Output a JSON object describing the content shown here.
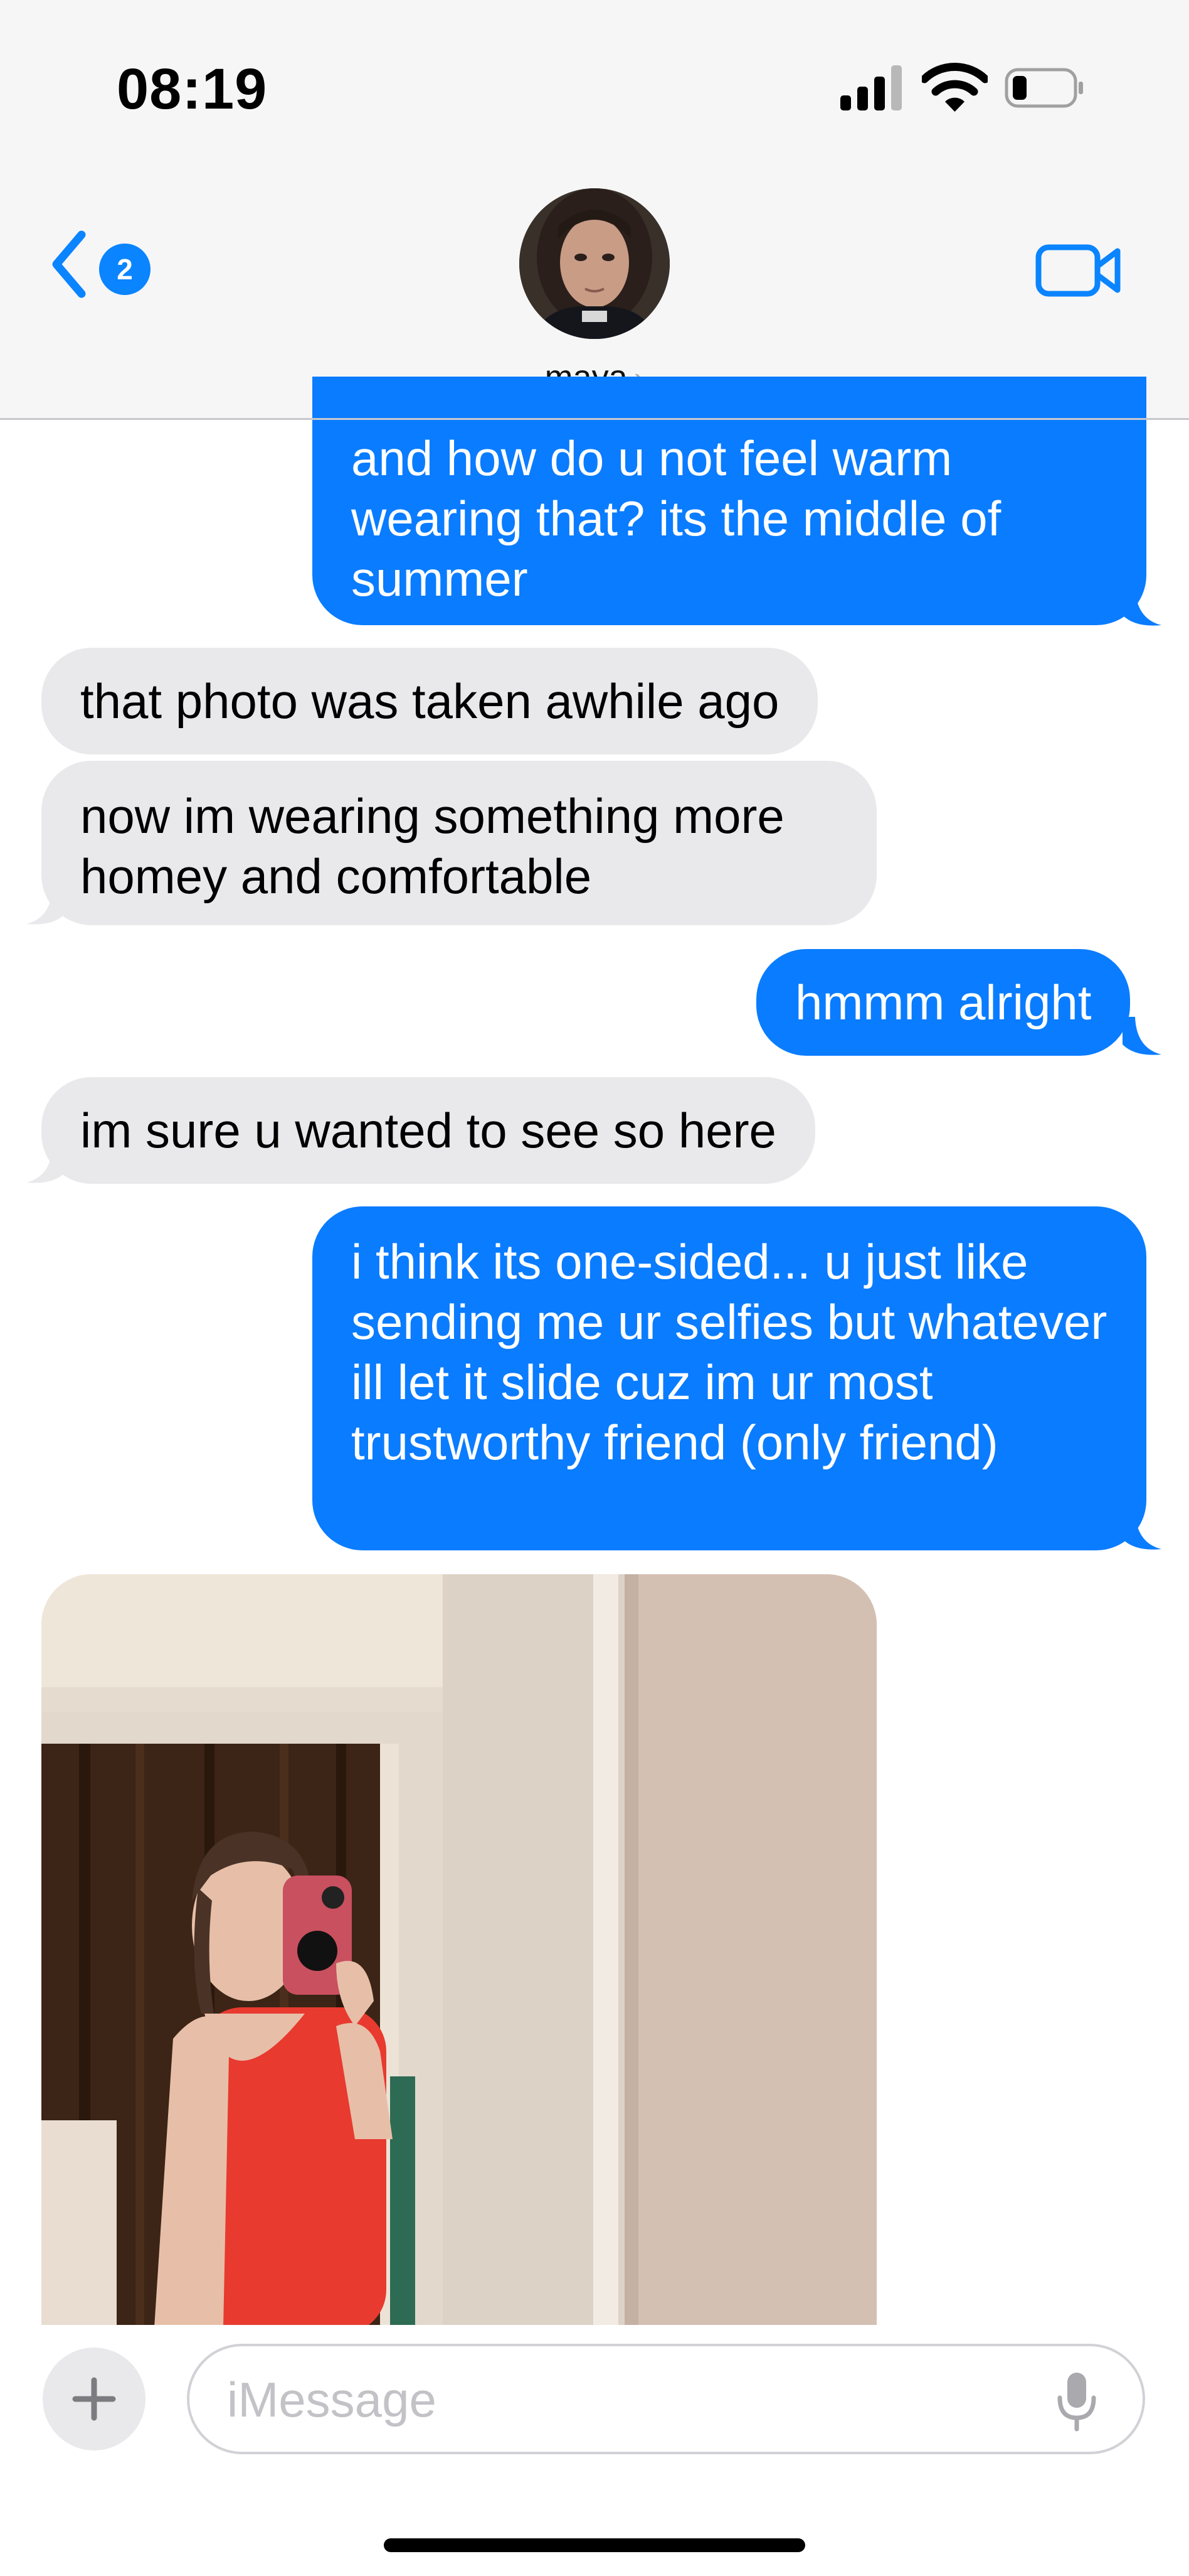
{
  "status_bar": {
    "time": "08:19",
    "icons": [
      "signal-icon",
      "wifi-icon",
      "battery-icon"
    ]
  },
  "header": {
    "back_badge": "2",
    "contact_name": "maya",
    "icons": [
      "back-chevron-icon",
      "video-camera-icon"
    ]
  },
  "messages": [
    {
      "from": "me",
      "text": "and how do u not feel warm wearing that? its the middle of summer"
    },
    {
      "from": "them",
      "text": "that photo was taken awhile ago"
    },
    {
      "from": "them",
      "text": "now im wearing something more homey and comfortable"
    },
    {
      "from": "me",
      "text": "hmmm alright"
    },
    {
      "from": "them",
      "text": "im sure u wanted to see so here"
    },
    {
      "from": "me",
      "text": "i think its one-sided... u just like sending me ur selfies but whatever ill let it slide cuz im ur most trustworthy friend (only friend)"
    },
    {
      "from": "them",
      "type": "photo"
    }
  ],
  "input": {
    "placeholder": "iMessage",
    "icons": [
      "plus-icon",
      "microphone-icon"
    ]
  },
  "colors": {
    "sent_bubble": "#0a7cff",
    "received_bubble": "#e9e9eb",
    "accent": "#0a84ff"
  }
}
